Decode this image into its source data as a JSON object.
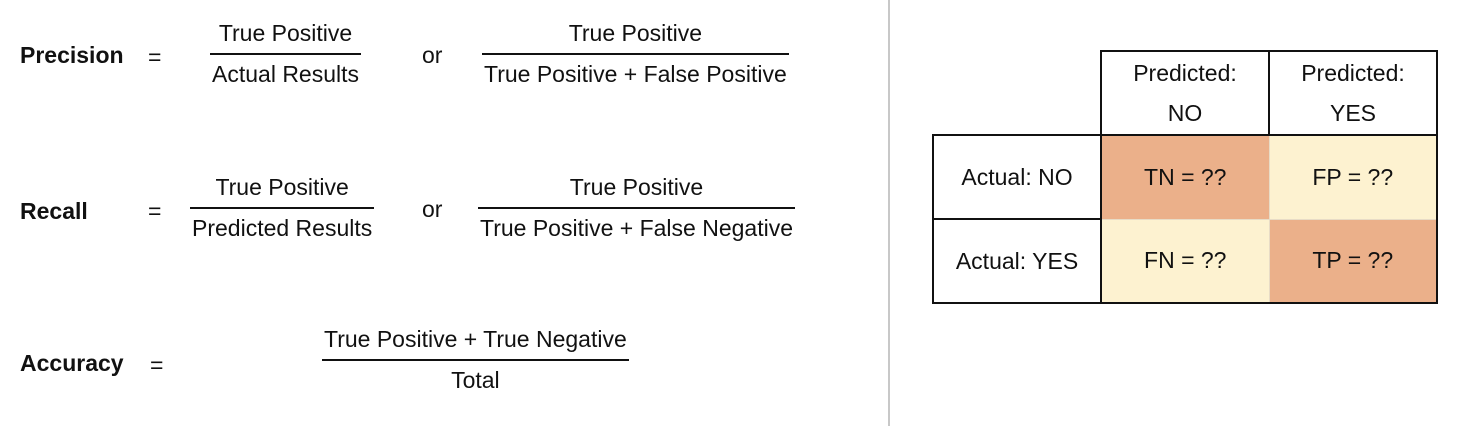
{
  "formulas": {
    "precision": {
      "term": "Precision",
      "equals": "=",
      "frac1": {
        "numerator": "True Positive",
        "denominator": "Actual Results"
      },
      "or": "or",
      "frac2": {
        "numerator": "True Positive",
        "denominator": "True Positive + False Positive"
      }
    },
    "recall": {
      "term": "Recall",
      "equals": "=",
      "frac1": {
        "numerator": "True Positive",
        "denominator": "Predicted Results"
      },
      "or": "or",
      "frac2": {
        "numerator": "True Positive",
        "denominator": "True Positive + False Negative"
      }
    },
    "accuracy": {
      "term": "Accuracy",
      "equals": "=",
      "frac1": {
        "numerator": "True Positive + True Negative",
        "denominator": "Total"
      }
    }
  },
  "matrix": {
    "col_headers": [
      "Predicted:\nNO",
      "Predicted:\nYES"
    ],
    "col_header_lines": [
      [
        "Predicted:",
        "NO"
      ],
      [
        "Predicted:",
        "YES"
      ]
    ],
    "row_headers": [
      "Actual: NO",
      "Actual: YES"
    ],
    "cells": [
      [
        "TN = ??",
        "FP = ??"
      ],
      [
        "FN = ??",
        "TP = ??"
      ]
    ],
    "colors": {
      "strong": "#ebb08a",
      "light": "#fdf2d0"
    }
  }
}
